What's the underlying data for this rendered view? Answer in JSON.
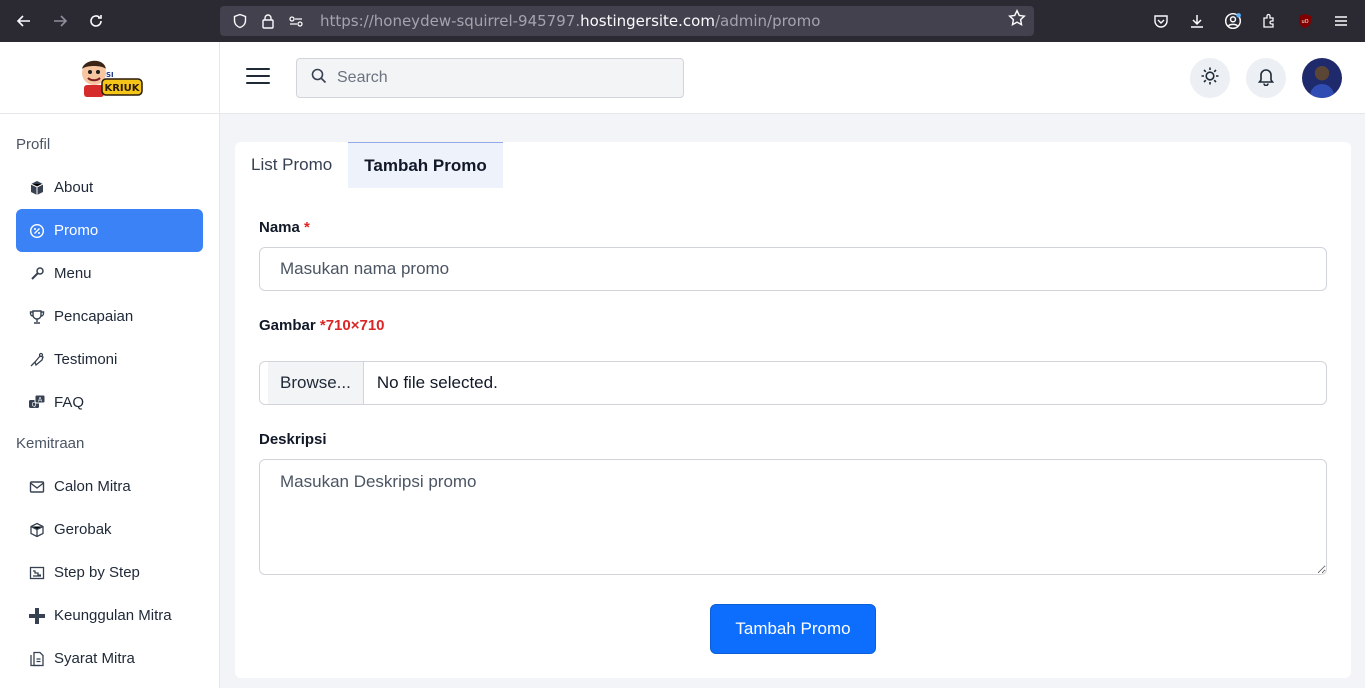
{
  "browser": {
    "url_prefix": "https://honeydew-squirrel-945797.",
    "url_host": "hostingersite.com",
    "url_path": "/admin/promo"
  },
  "sidebar": {
    "logo_text": "SI KRIUK",
    "sections": [
      {
        "title": "Profil",
        "items": [
          {
            "label": "About",
            "icon": "box-icon"
          },
          {
            "label": "Promo",
            "icon": "promo-icon",
            "active": true
          },
          {
            "label": "Menu",
            "icon": "wrench-icon"
          },
          {
            "label": "Pencapaian",
            "icon": "trophy-icon"
          },
          {
            "label": "Testimoni",
            "icon": "testimonial-icon"
          },
          {
            "label": "FAQ",
            "icon": "faq-icon"
          }
        ]
      },
      {
        "title": "Kemitraan",
        "items": [
          {
            "label": "Calon Mitra",
            "icon": "mail-icon"
          },
          {
            "label": "Gerobak",
            "icon": "cart-box-icon"
          },
          {
            "label": "Step by Step",
            "icon": "steps-icon"
          },
          {
            "label": "Keunggulan Mitra",
            "icon": "plus-icon"
          },
          {
            "label": "Syarat Mitra",
            "icon": "document-icon"
          }
        ]
      }
    ]
  },
  "header": {
    "search_placeholder": "Search"
  },
  "tabs": [
    {
      "label": "List Promo",
      "active": false
    },
    {
      "label": "Tambah Promo",
      "active": true
    }
  ],
  "form": {
    "nama_label": "Nama",
    "nama_required": "*",
    "nama_placeholder": "Masukan nama promo",
    "gambar_label": "Gambar",
    "gambar_required": "*710×710",
    "browse_label": "Browse...",
    "file_status": "No file selected.",
    "deskripsi_label": "Deskripsi",
    "deskripsi_placeholder": "Masukan Deskripsi promo",
    "submit_label": "Tambah Promo"
  },
  "colors": {
    "accent": "#3b82f6",
    "primary_button": "#0d6efd",
    "required": "#dc2626"
  }
}
